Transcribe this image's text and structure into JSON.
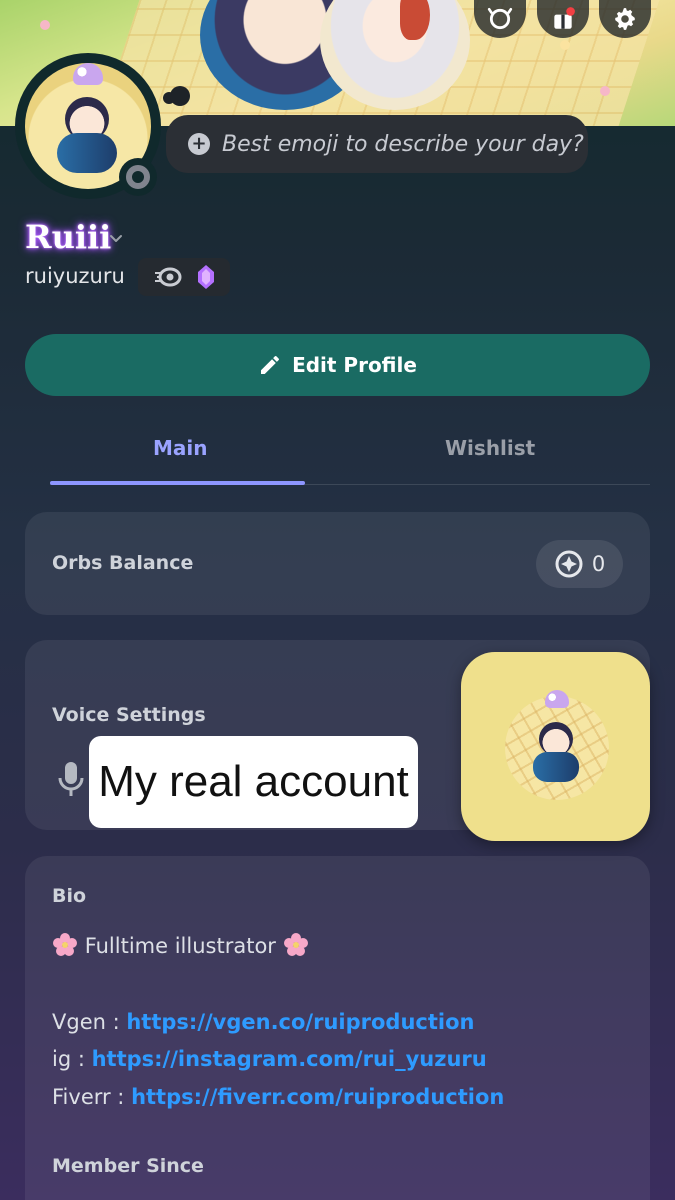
{
  "status": {
    "placeholder": "Best emoji to describe your day?"
  },
  "profile": {
    "display_name": "Ruiii",
    "username": "ruiyuzuru"
  },
  "actions": {
    "edit_profile_label": "Edit Profile"
  },
  "tabs": [
    {
      "label": "Main",
      "active": true
    },
    {
      "label": "Wishlist",
      "active": false
    }
  ],
  "orbs": {
    "label": "Orbs Balance",
    "value": "0"
  },
  "voice": {
    "label": "Voice Settings"
  },
  "overlay": {
    "caption": "My real account"
  },
  "bio": {
    "label": "Bio",
    "title_line": "Fulltime illustrator",
    "links": [
      {
        "prefix": "Vgen : ",
        "url": "https://vgen.co/ruiproduction"
      },
      {
        "prefix": "ig : ",
        "url": "https://instagram.com/rui_yuzuru"
      },
      {
        "prefix": "Fiverr : ",
        "url": "https://fiverr.com/ruiproduction"
      }
    ]
  },
  "member_since": {
    "label": "Member Since"
  },
  "icons": {
    "top_buttons": [
      "shop-icon",
      "nitro-gift-icon",
      "settings-icon"
    ],
    "badges": [
      "nitro-badge-icon",
      "boost-gem-icon"
    ]
  },
  "colors": {
    "accent_tab": "#9aa3ff",
    "edit_button": "#1a6b63",
    "link": "#2e9bff",
    "name_glow": "#b15cff"
  }
}
